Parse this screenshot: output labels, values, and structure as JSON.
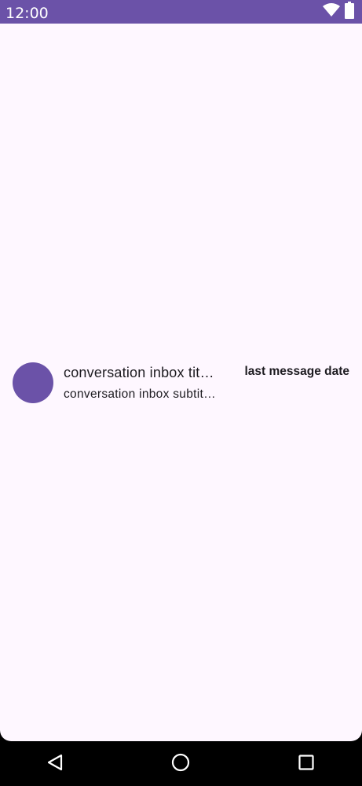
{
  "status_bar": {
    "time": "12:00",
    "background_color": "#6b52a8",
    "icons": [
      "wifi-icon",
      "battery-icon"
    ]
  },
  "conversation": {
    "title": "conversation inbox tit…",
    "subtitle": "conversation inbox subtit…",
    "date": "last message date",
    "avatar_color": "#6b52a8"
  },
  "nav_bar": {
    "buttons": [
      "back-icon",
      "home-icon",
      "recents-icon"
    ]
  },
  "colors": {
    "accent": "#6b52a8",
    "surface": "#fef7ff",
    "text": "#1d1b20"
  }
}
